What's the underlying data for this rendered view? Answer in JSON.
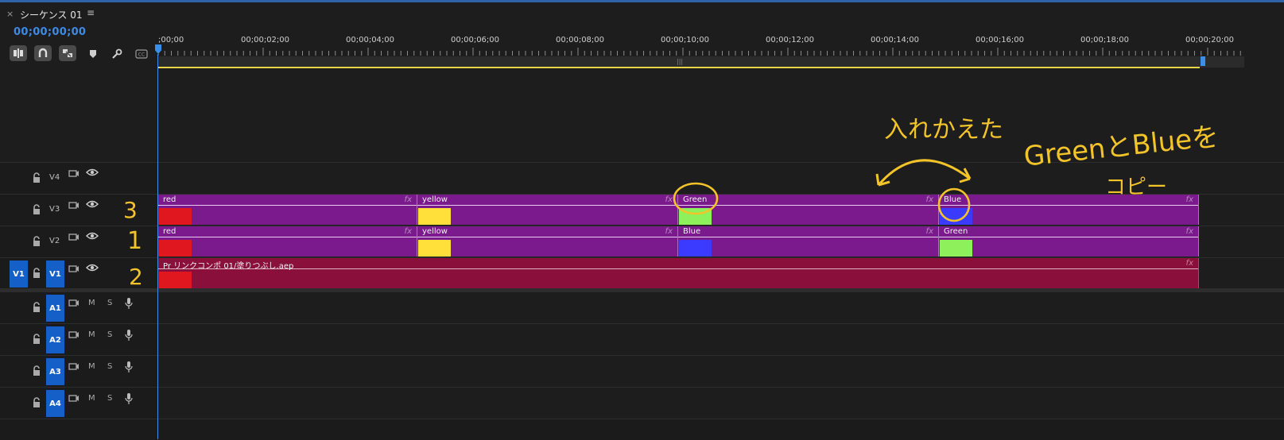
{
  "panel": {
    "close_glyph": "×",
    "title": "シーケンス 01",
    "menu_glyph": "≡",
    "timecode": "00;00;00;00"
  },
  "toolbar": [
    {
      "name": "insert-nest-toggle-icon",
      "active": true
    },
    {
      "name": "snap-magnet-icon",
      "active": true
    },
    {
      "name": "linked-selection-icon",
      "active": true
    },
    {
      "name": "add-marker-icon",
      "active": false
    },
    {
      "name": "wrench-settings-icon",
      "active": false
    },
    {
      "name": "captions-icon",
      "active": false
    }
  ],
  "ruler": {
    "labels": [
      ";00;00",
      "00;00;02;00",
      "00;00;04;00",
      "00;00;06;00",
      "00;00;08;00",
      "00;00;10;00",
      "00;00;12;00",
      "00;00;14;00",
      "00;00;16;00",
      "00;00;18;00",
      "00;00;20;00"
    ]
  },
  "tracks": {
    "video": [
      {
        "id": "V4",
        "label": "V4"
      },
      {
        "id": "V3",
        "label": "V3"
      },
      {
        "id": "V2",
        "label": "V2"
      },
      {
        "id": "V1",
        "label": "V1",
        "source_label": "V1"
      }
    ],
    "audio": [
      {
        "id": "A1",
        "label": "A1",
        "mute": "M",
        "solo": "S"
      },
      {
        "id": "A2",
        "label": "A2",
        "mute": "M",
        "solo": "S"
      },
      {
        "id": "A3",
        "label": "A3",
        "mute": "M",
        "solo": "S"
      },
      {
        "id": "A4",
        "label": "A4",
        "mute": "M",
        "solo": "S"
      }
    ]
  },
  "clips": {
    "V3": [
      {
        "label": "red",
        "fx": "fx",
        "color": "#e0171e"
      },
      {
        "label": "yellow",
        "fx": "fx",
        "color": "#ffe03a"
      },
      {
        "label": "Green",
        "fx": "fx",
        "color": "#8ef05a"
      },
      {
        "label": "Blue",
        "fx": "fx",
        "color": "#3b3bff"
      }
    ],
    "V2": [
      {
        "label": "red",
        "fx": "fx",
        "color": "#e0171e"
      },
      {
        "label": "yellow",
        "fx": "fx",
        "color": "#ffe03a"
      },
      {
        "label": "Blue",
        "fx": "fx",
        "color": "#3b3bff"
      },
      {
        "label": "Green",
        "fx": "fx",
        "color": "#8ef05a"
      }
    ],
    "V1": [
      {
        "label": "Pr リンクコンポ 01/塗りつぶし.aep",
        "fx": "fx",
        "color": "#e0171e"
      }
    ]
  },
  "annotations": {
    "swapped": "入れかえた",
    "copy_note_line1": "GreenとBlueを",
    "copy_note_line2": "コピー",
    "num_v3": "3",
    "num_v2": "1",
    "num_v1": "2"
  },
  "colors": {
    "accent": "#3b8eea",
    "clip_purple": "#7a1a8c",
    "clip_v1": "#8a0f3a",
    "annotation": "#f3c42a"
  }
}
